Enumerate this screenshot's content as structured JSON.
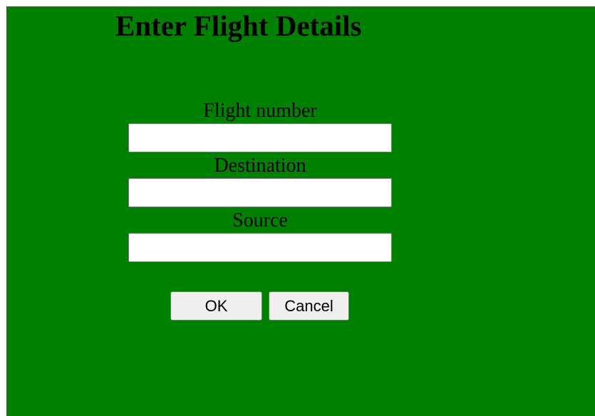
{
  "page": {
    "title": "Enter Flight Details",
    "background_color": "#008000"
  },
  "form": {
    "fields": [
      {
        "label": "Flight number",
        "value": "",
        "placeholder": ""
      },
      {
        "label": "Destination",
        "value": "",
        "placeholder": ""
      },
      {
        "label": "Source",
        "value": "",
        "placeholder": ""
      }
    ]
  },
  "buttons": {
    "ok_label": "OK",
    "cancel_label": "Cancel"
  }
}
